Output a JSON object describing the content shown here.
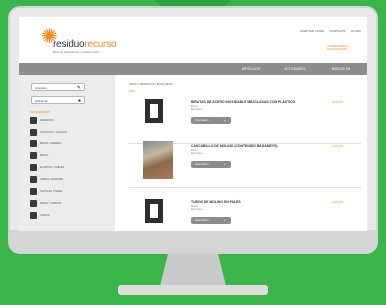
{
  "header": {
    "brand_part1": "residuo",
    "brand_part2": "recurso",
    "logo_icon": "sun-logo-icon",
    "tagline": "Bolsa de subproductos y residuos online",
    "top_links": [
      "ACEPTAR LOGIN",
      "CONTACTO",
      "AYUDA"
    ],
    "promo": "¿ES NECESARIO REGISTRARSE?"
  },
  "nav": {
    "tabs": [
      "ARTÍCULOS",
      "ACTIVIDADES",
      "BUSCAR EN"
    ]
  },
  "sidebar": {
    "search_label": "Artículos",
    "search_icon": "pencil-icon",
    "filter_label": "Ubicación",
    "filter_icon": "chat-icon",
    "categories_heading": "CATEGORÍAS",
    "categories": [
      "RESIDUOS",
      "PLÁSTICO Y CAUCHO",
      "METAL / MADERA",
      "METAL",
      "EQUIPOS / CABLES",
      "VIDRIO / ENVASES",
      "TEXTILES / PAPEL",
      "PAPEL / CARTÓN",
      "VARIOS"
    ]
  },
  "main": {
    "breadcrumb": "INICIO / RESIDUOS / BÚSQUEDA",
    "results_count": "RES.",
    "listings": [
      {
        "title": "BIRUTAS DE ACERO INOXIDABLE MEZCLADAS CON PLÁSTICO",
        "meta_line1": "Metal",
        "meta_line2": "Barcelona",
        "price": "GRATIS",
        "button_label": "Información",
        "thumb": "document-icon"
      },
      {
        "title": "CASCABILLO DE MOLINO (CONTENIDO BAGAMEYS)",
        "meta_line1": "Otros",
        "meta_line2": "Barcelona",
        "price": "GRATIS",
        "button_label": "Información",
        "thumb": "photo"
      },
      {
        "title": "TUBOS DE MOLINO EN PALÉS",
        "meta_line1": "Metal",
        "meta_line2": "Barcelona",
        "price": "GRATIS",
        "button_label": "Información",
        "thumb": "document-icon"
      }
    ]
  },
  "colors": {
    "background": "#39b54a",
    "accent": "#f08a24",
    "nav": "#8d8d8d"
  }
}
